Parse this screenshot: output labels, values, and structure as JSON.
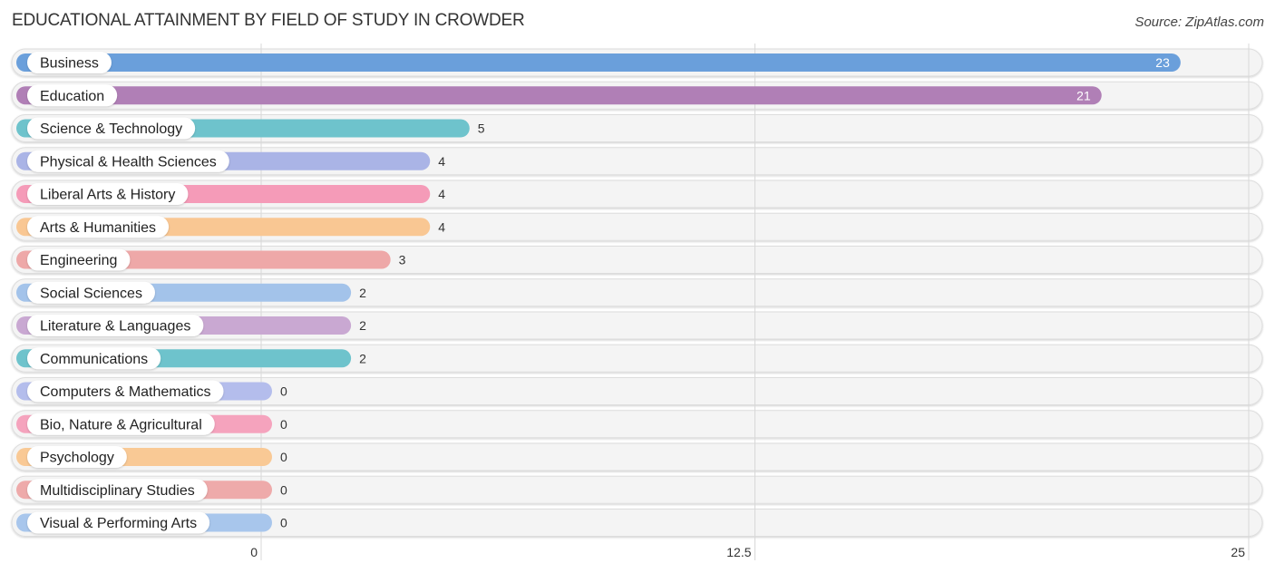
{
  "header": {
    "title": "EDUCATIONAL ATTAINMENT BY FIELD OF STUDY IN CROWDER",
    "source": "Source: ZipAtlas.com"
  },
  "chart_data": {
    "type": "bar",
    "orientation": "horizontal",
    "title": "EDUCATIONAL ATTAINMENT BY FIELD OF STUDY IN CROWDER",
    "xlabel": "",
    "ylabel": "",
    "xlim": [
      0,
      25
    ],
    "xticks": [
      0,
      12.5,
      25
    ],
    "xtick_labels": [
      "0",
      "12.5",
      "25"
    ],
    "grid": true,
    "categories": [
      "Business",
      "Education",
      "Science & Technology",
      "Physical & Health Sciences",
      "Liberal Arts & History",
      "Arts & Humanities",
      "Engineering",
      "Social Sciences",
      "Literature & Languages",
      "Communications",
      "Computers & Mathematics",
      "Bio, Nature & Agricultural",
      "Psychology",
      "Multidisciplinary Studies",
      "Visual & Performing Arts"
    ],
    "values": [
      23,
      21,
      5,
      4,
      4,
      4,
      3,
      2,
      2,
      2,
      0,
      0,
      0,
      0,
      0
    ],
    "value_labels": [
      "23",
      "21",
      "5",
      "4",
      "4",
      "4",
      "3",
      "2",
      "2",
      "2",
      "0",
      "0",
      "0",
      "0",
      "0"
    ],
    "colors": [
      "#6a9fdb",
      "#b07fb6",
      "#6ec3cc",
      "#aab4e6",
      "#f59bb8",
      "#f9c793",
      "#eea8a8",
      "#a3c3ea",
      "#c9a8d2",
      "#6ec3cc",
      "#b4bdec",
      "#f5a3bd",
      "#f9c995",
      "#eeaaaa",
      "#a8c6ec"
    ],
    "source": "Source: ZipAtlas.com"
  }
}
